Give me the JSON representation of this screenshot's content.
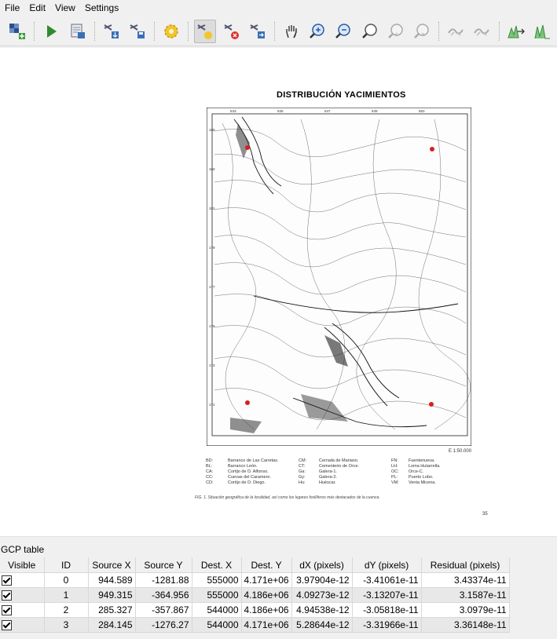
{
  "menu": [
    "File",
    "Edit",
    "View",
    "Settings"
  ],
  "toolbar": {
    "buttons": [
      {
        "name": "open-raster-icon"
      },
      {
        "name": "start-georeferencing-icon"
      },
      {
        "name": "generate-gdal-script-icon"
      },
      {
        "name": "load-gcp-points-icon"
      },
      {
        "name": "save-gcp-points-icon"
      },
      {
        "name": "transformation-settings-icon"
      },
      {
        "name": "add-point-icon"
      },
      {
        "name": "delete-point-icon"
      },
      {
        "name": "move-gcp-point-icon"
      },
      {
        "name": "pan-icon"
      },
      {
        "name": "zoom-in-icon"
      },
      {
        "name": "zoom-out-icon"
      },
      {
        "name": "zoom-to-layer-icon"
      },
      {
        "name": "zoom-last-icon"
      },
      {
        "name": "zoom-next-icon"
      },
      {
        "name": "link-georeferencer-icon"
      },
      {
        "name": "link-qgis-icon"
      },
      {
        "name": "full-histogram-stretch-icon"
      },
      {
        "name": "local-histogram-stretch-icon"
      }
    ]
  },
  "document": {
    "title": "DISTRIBUCIÓN   YACIMIENTOS",
    "scale": "E 1:50.000",
    "legend": [
      [
        "BD:",
        "Barranco de Las Carretas.",
        "CM:",
        "Cerrada de Mariano.",
        "FN:",
        "Fuentenueva."
      ],
      [
        "BL:",
        "Barranco León.",
        "CT:",
        "Cementerio de Orce.",
        "LH:",
        "Loma Hutarrella."
      ],
      [
        "CA:",
        "Cortijo de D. Alfonso.",
        "Ga:",
        "Galera-1.",
        "OC:",
        "Orce-C."
      ],
      [
        "CC:",
        "Cuevas del Caramero.",
        "Gy:",
        "Galera-2.",
        "PL:",
        "Puerto Lobo."
      ],
      [
        "CD:",
        "Cortijo de D. Diego.",
        "Hu:",
        "Huéscar.",
        "VM:",
        "Venta Micena."
      ]
    ],
    "caption": "FIG. 1. Situación geográfica de la localidad, así como los lugares fosilíferos más destacados de la cuenca.",
    "page_number": "35"
  },
  "gcp": {
    "label": "GCP table",
    "columns": [
      "Visible",
      "ID",
      "Source X",
      "Source Y",
      "Dest. X",
      "Dest. Y",
      "dX (pixels)",
      "dY (pixels)",
      "Residual (pixels)"
    ],
    "rows": [
      {
        "visible": true,
        "id": "0",
        "source_x": "944.589",
        "source_y": "-1281.88",
        "dest_x": "555000",
        "dest_y": "4.171e+06",
        "dx": "3.97904e-12",
        "dy": "-3.41061e-11",
        "residual": "3.43374e-11"
      },
      {
        "visible": true,
        "id": "1",
        "source_x": "949.315",
        "source_y": "-364.956",
        "dest_x": "555000",
        "dest_y": "4.186e+06",
        "dx": "4.09273e-12",
        "dy": "-3.13207e-11",
        "residual": "3.1587e-11"
      },
      {
        "visible": true,
        "id": "2",
        "source_x": "285.327",
        "source_y": "-357.867",
        "dest_x": "544000",
        "dest_y": "4.186e+06",
        "dx": "4.94538e-12",
        "dy": "-3.05818e-11",
        "residual": "3.0979e-11"
      },
      {
        "visible": true,
        "id": "3",
        "source_x": "284.145",
        "source_y": "-1276.27",
        "dest_x": "544000",
        "dest_y": "4.171e+06",
        "dx": "5.28644e-12",
        "dy": "-3.31966e-11",
        "residual": "3.36148e-11"
      }
    ]
  }
}
